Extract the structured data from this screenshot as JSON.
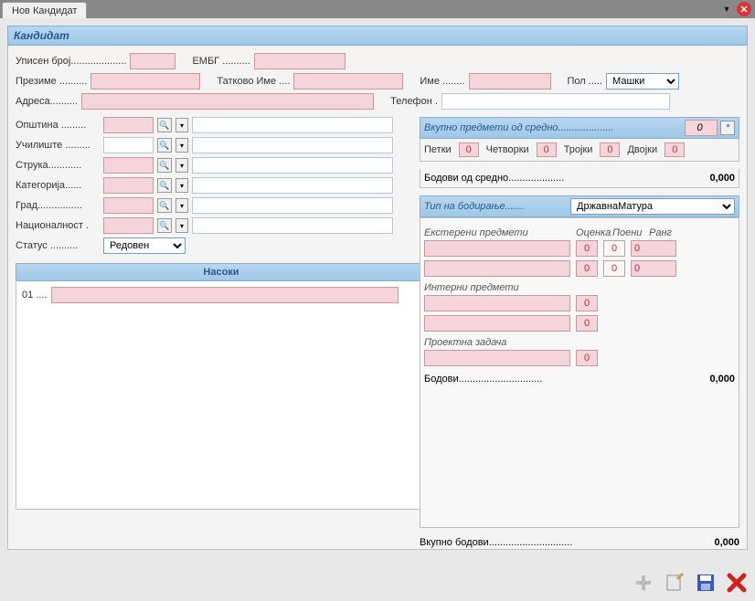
{
  "tab": {
    "title": "Нов Кандидат"
  },
  "panel": {
    "title": "Кандидат"
  },
  "fields": {
    "upisen_broj": "Уписен број",
    "embg": "ЕМБГ",
    "prezime": "Презиме",
    "tatkovo": "Татково Име",
    "ime": "Име",
    "pol": "Пол",
    "pol_value": "Машки",
    "adresa": "Адреса",
    "telefon": "Телефон",
    "opstina": "Општина",
    "uciliste": "Училиште",
    "struka": "Струка",
    "kategorija": "Категорија",
    "grad": "Град",
    "nacionalnost": "Националност",
    "status": "Статус",
    "status_value": "Редовен"
  },
  "nasoki": {
    "title": "Насоки",
    "row1": "01"
  },
  "right": {
    "vkupno_predmeti": "Вкупно предмети од средно",
    "vkupno_predmeti_val": "0",
    "petki": "Петки",
    "cetvorki": "Четворки",
    "trojki": "Тројки",
    "dvojki": "Двојки",
    "petki_v": "0",
    "cetvorki_v": "0",
    "trojki_v": "0",
    "dvojki_v": "0",
    "bodovi_sredno": "Бодови од средно",
    "bodovi_sredno_val": "0,000",
    "tip_bod": "Тип на бодирање",
    "tip_bod_val": "ДржавнаМатура",
    "eksterni": "Екстерени предмети",
    "ocenka": "Оценка",
    "poeni": "Поени",
    "rang": "Ранг",
    "interni": "Интерни предмети",
    "proektna": "Проектна задача",
    "bodovi": "Бодови",
    "bodovi_val": "0,000",
    "grade0": "0"
  },
  "totals": {
    "vkupno": "Вкупно бодови",
    "vkupno_val": "0,000"
  },
  "dots": "..........",
  "dots_long": "....................",
  "dots_med": "...............",
  "star": "*"
}
